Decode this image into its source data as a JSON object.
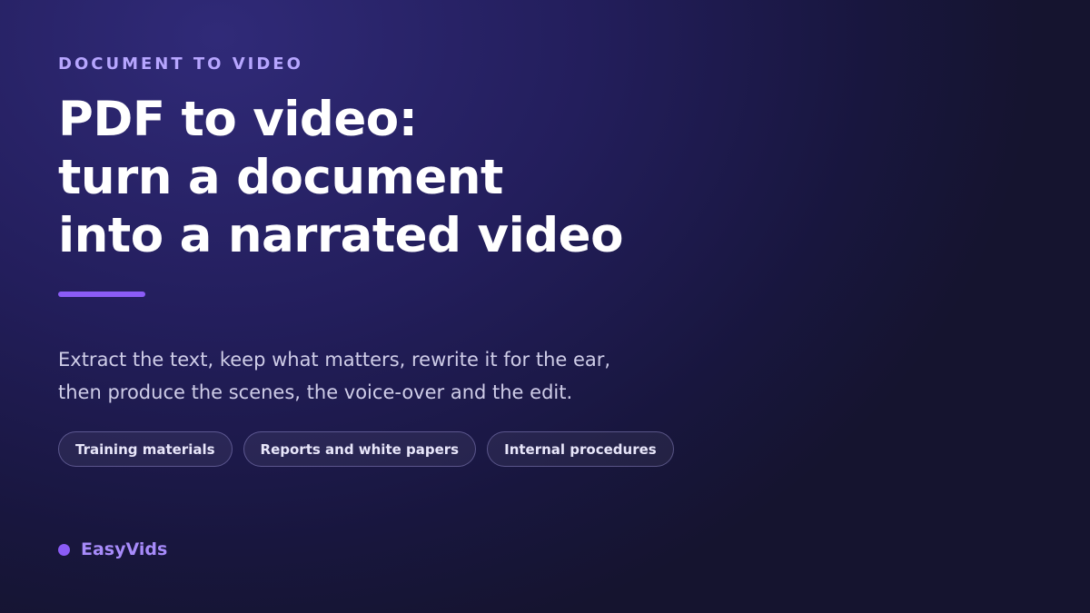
{
  "eyebrow": "DOCUMENT TO VIDEO",
  "headline": {
    "lines": [
      "PDF to video:",
      "turn a document",
      "into a narrated video"
    ]
  },
  "lede": {
    "lines": [
      "Extract the text, keep what matters, rewrite it for the ear,",
      "then produce the scenes, the voice-over and the edit."
    ]
  },
  "tags": [
    "Training materials",
    "Reports and white papers",
    "Internal procedures"
  ],
  "brand": {
    "name": "EasyVids"
  },
  "colors": {
    "accent": "#8b5cf6",
    "eyebrow": "#b7a6ff",
    "brand": "#a78bfa",
    "background": "#231e5c"
  }
}
